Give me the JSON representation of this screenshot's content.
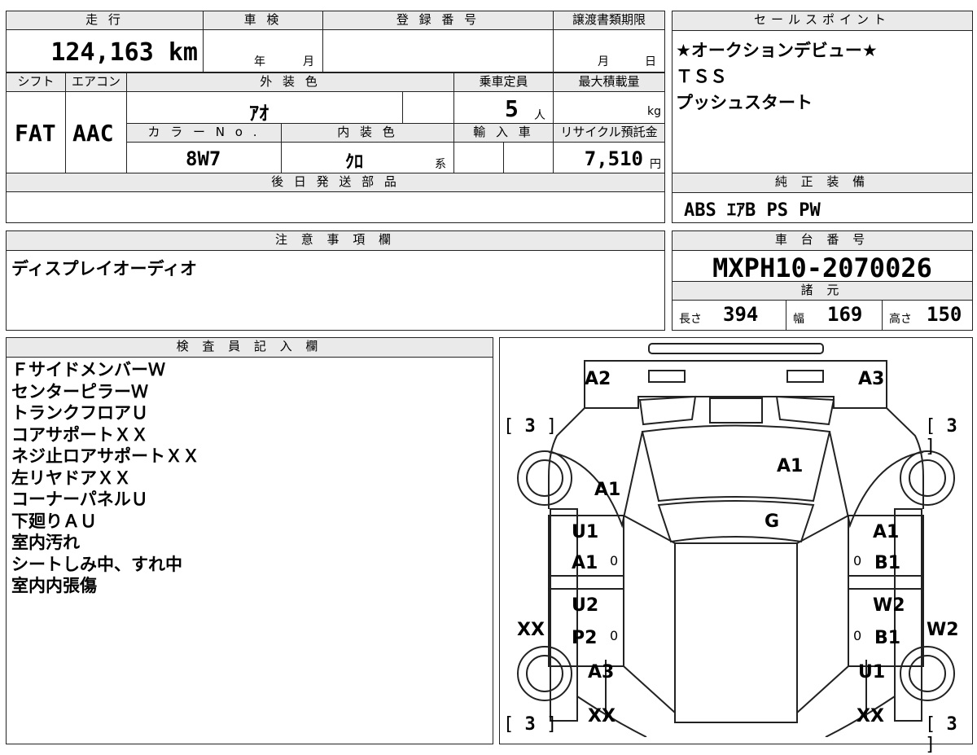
{
  "vehicle": {
    "mileage_label": "走 行",
    "mileage_value": "124,163 km",
    "inspection_label": "車 検",
    "inspection_year_unit": "年",
    "inspection_month_unit": "月",
    "registration_label": "登 録 番 号",
    "transfer_deadline_label": "譲渡書類期限",
    "transfer_month_unit": "月",
    "transfer_day_unit": "日",
    "shift_label": "シフト",
    "shift_value": "FAT",
    "aircon_label": "エアコン",
    "aircon_value": "AAC",
    "exterior_color_label": "外 装 色",
    "exterior_color_value": "ｱｵ",
    "capacity_label": "乗車定員",
    "capacity_value": "5",
    "capacity_unit": "人",
    "max_load_label": "最大積載量",
    "max_load_unit": "kg",
    "color_no_label": "カ ラ ー N o .",
    "color_no_value": "8W7",
    "interior_color_label": "内 装 色",
    "interior_color_value": "ｸﾛ",
    "interior_color_suffix": "系",
    "import_label": "輸 入 車",
    "recycle_label": "リサイクル預託金",
    "recycle_value": "7,510",
    "recycle_unit": "円",
    "later_parts_label": "後 日 発 送 部 品"
  },
  "sales_points": {
    "title": "セールスポイント",
    "lines": [
      "★オークションデビュー★",
      "ＴＳＳ",
      "プッシュスタート"
    ]
  },
  "standard_equipment": {
    "title": "純 正 装 備",
    "value": "ABS ｴｱB PS PW"
  },
  "notes": {
    "title": "注 意 事 項 欄",
    "text": "ディスプレイオーディオ"
  },
  "chassis": {
    "title": "車 台 番 号",
    "value": "MXPH10-2070026",
    "specs_title": "諸 元",
    "length_label": "長さ",
    "length_value": "394",
    "width_label": "幅",
    "width_value": "169",
    "height_label": "高さ",
    "height_value": "150"
  },
  "inspector": {
    "title": "検 査 員 記 入 欄",
    "lines": [
      "ＦサイドメンバーＷ",
      "センターピラーＷ",
      "トランクフロアＵ",
      "コアサポートＸＸ",
      "ネジ止ロアサポートＸＸ",
      "左リヤドアＸＸ",
      "コーナーパネルＵ",
      "下廻りＡＵ",
      "室内汚れ",
      "シートしみ中、すれ中",
      "室内内張傷"
    ]
  },
  "diagram": {
    "labels": {
      "front_left": "A2",
      "front_right": "A3",
      "tire_fl": "3",
      "tire_fr": "3",
      "tire_rl": "3",
      "tire_rr": "3",
      "hood": "A1",
      "left_fender": "A1",
      "windshield": "G",
      "lf_door_top": "U1",
      "lf_door_bottom": "A1",
      "lf_door_mark": "0",
      "rf_door_top": "A1",
      "rf_door_bottom": "B1",
      "rf_door_mark": "0",
      "lr_door_top": "U2",
      "lr_door_bottom": "P2",
      "lr_door_mark": "0",
      "rr_door_top": "W2",
      "rr_door_bottom": "B1",
      "rr_door_mark": "0",
      "left_sill": "XX",
      "right_sill": "W2",
      "left_quarter": "A3",
      "right_quarter": "U1",
      "rear_left": "XX",
      "rear_right": "XX"
    }
  }
}
